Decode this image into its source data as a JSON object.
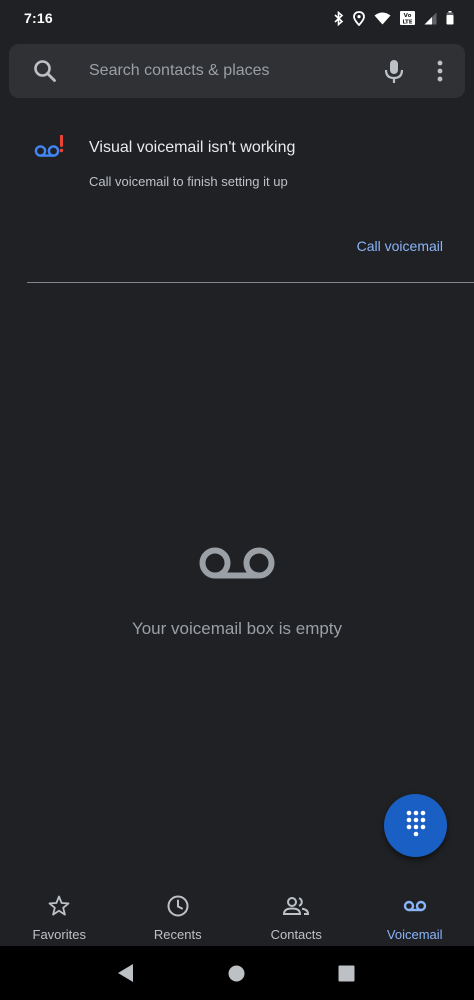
{
  "status_bar": {
    "time": "7:16",
    "icons": [
      "bluetooth-icon",
      "location-icon",
      "wifi-icon",
      "volte-icon",
      "signal-icon",
      "battery-icon"
    ],
    "volte_text": "Vo LTE"
  },
  "search": {
    "placeholder": "Search contacts & places",
    "value": ""
  },
  "banner": {
    "title": "Visual voicemail isn't working",
    "subtitle": "Call voicemail to finish setting it up",
    "action": "Call voicemail"
  },
  "empty_state": {
    "message": "Your voicemail box is empty"
  },
  "bottom_nav": {
    "items": [
      {
        "label": "Favorites",
        "icon": "star-icon"
      },
      {
        "label": "Recents",
        "icon": "clock-icon"
      },
      {
        "label": "Contacts",
        "icon": "people-icon"
      },
      {
        "label": "Voicemail",
        "icon": "voicemail-icon"
      }
    ],
    "active": "Voicemail"
  },
  "colors": {
    "background": "#202124",
    "search_bg": "#303134",
    "accent": "#8ab4f8",
    "fab": "#1a5fc4",
    "alert_red": "#ea4335",
    "voicemail_blue": "#4285f4"
  }
}
